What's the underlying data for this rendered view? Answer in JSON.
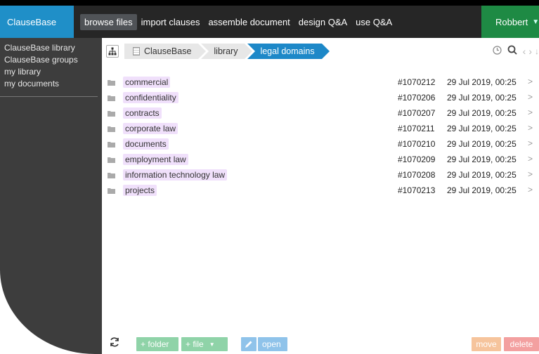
{
  "header": {
    "brand": "ClauseBase",
    "nav": [
      "browse files",
      "import clauses",
      "assemble document",
      "design Q&A",
      "use Q&A"
    ],
    "user": "Robbert"
  },
  "sidebar": {
    "items": [
      "ClauseBase library",
      "ClauseBase groups",
      "my library",
      "my documents"
    ]
  },
  "breadcrumb": [
    "ClauseBase",
    "library",
    "legal domains"
  ],
  "files": [
    {
      "name": "commercial",
      "id": "#1070212",
      "date": "29 Jul 2019, 00:25"
    },
    {
      "name": "confidentiality",
      "id": "#1070206",
      "date": "29 Jul 2019, 00:25"
    },
    {
      "name": "contracts",
      "id": "#1070207",
      "date": "29 Jul 2019, 00:25"
    },
    {
      "name": "corporate law",
      "id": "#1070211",
      "date": "29 Jul 2019, 00:25"
    },
    {
      "name": "documents",
      "id": "#1070210",
      "date": "29 Jul 2019, 00:25"
    },
    {
      "name": "employment law",
      "id": "#1070209",
      "date": "29 Jul 2019, 00:25"
    },
    {
      "name": "information technology law",
      "id": "#1070208",
      "date": "29 Jul 2019, 00:25"
    },
    {
      "name": "projects",
      "id": "#1070213",
      "date": "29 Jul 2019, 00:25"
    }
  ],
  "toolbar": {
    "add_folder": "+ folder",
    "add_file": "+ file",
    "open": "open",
    "move": "move",
    "delete": "delete"
  }
}
